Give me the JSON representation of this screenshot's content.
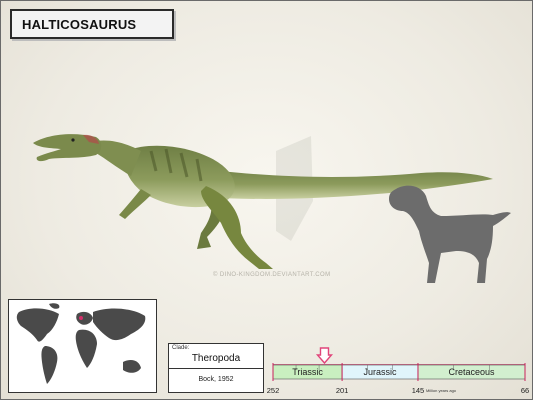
{
  "title": "HALTICOSAURUS",
  "watermark": "© DINO-KINGDOM.DEVIANTART.COM",
  "clade": {
    "label": "Clade:",
    "name": "Theropoda",
    "author": "Bock, 1952"
  },
  "timeline": {
    "periods": [
      {
        "name": "Triassic",
        "start": 252,
        "end": 201,
        "color": "#c9efc0"
      },
      {
        "name": "Jurassic",
        "start": 201,
        "end": 145,
        "color": "#e0f5fb"
      },
      {
        "name": "Cretaceous",
        "start": 145,
        "end": 66,
        "color": "#d2efcf"
      }
    ],
    "ticks": [
      "252",
      "201",
      "145",
      "66"
    ],
    "units": "Million years ago",
    "marker_mya": 214,
    "marker_color": "#e0457a",
    "boundary_color": "#c9215b"
  },
  "map": {
    "ocean_color": "#ffffff",
    "land_color": "#4a4a4a",
    "fossil_site_color": "#d32f6a"
  },
  "scene": {
    "dinosaur_color": "#8a9a5a",
    "scale_silhouette": "dog"
  }
}
